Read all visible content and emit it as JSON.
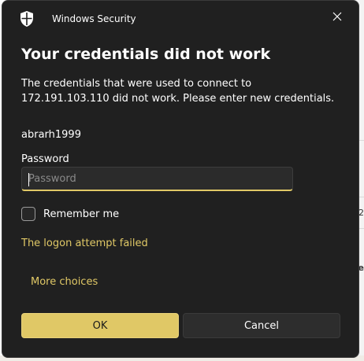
{
  "dialog": {
    "app_title": "Windows Security",
    "heading": "Your credentials did not work",
    "message": "The credentials that were used to connect to 172.191.103.110 did not work. Please enter new credentials.",
    "username": "abrarh1999",
    "password_label": "Password",
    "password_value": "",
    "password_placeholder": "Password",
    "remember_label": "Remember me",
    "remember_checked": false,
    "error_text": "The logon attempt failed",
    "more_choices_label": "More choices",
    "ok_label": "OK",
    "cancel_label": "Cancel"
  },
  "background": {
    "fragment_1": "2",
    "fragment_2": "Te"
  },
  "colors": {
    "dialog_bg": "#202020",
    "accent": "#e0c866",
    "text": "#ffffff"
  }
}
